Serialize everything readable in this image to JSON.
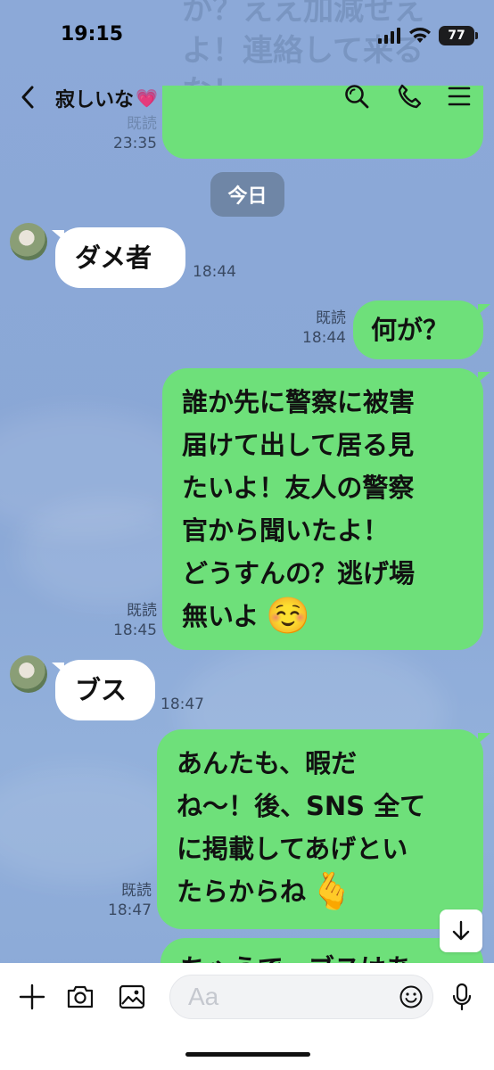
{
  "status_bar": {
    "time": "19:15",
    "battery": "77",
    "icons": [
      "signal-icon",
      "wifi-icon",
      "battery-icon"
    ]
  },
  "header": {
    "title": "寂しいな",
    "title_emoji": "💗",
    "icons": [
      "back-chevron-icon",
      "search-icon",
      "phone-icon",
      "menu-icon"
    ]
  },
  "overlay_text": "か？ええ加減せえよ！連絡して来るな！",
  "date_chip": "今日",
  "messages": [
    {
      "id": "prev",
      "direction": "out",
      "text": "",
      "read": "既読",
      "time": "23:35"
    },
    {
      "id": "m1",
      "direction": "in",
      "text": "ダメ者",
      "time": "18:44"
    },
    {
      "id": "m2",
      "direction": "out",
      "text": "何が？",
      "read": "既読",
      "time": "18:44"
    },
    {
      "id": "m3",
      "direction": "out",
      "lines": [
        "誰か先に警察に被害",
        "届けて出して居る見",
        "たいよ！友人の警察",
        "官から聞いたよ！",
        "どうすんの？逃げ場",
        "無いよ"
      ],
      "emoji": "☺️",
      "read": "既読",
      "time": "18:45"
    },
    {
      "id": "m4",
      "direction": "in",
      "text": "ブス",
      "time": "18:47"
    },
    {
      "id": "m5",
      "direction": "out",
      "lines": [
        "あんたも、暇だ",
        "ね〜！後、SNS 全て",
        "に掲載してあげとい",
        "たらからね"
      ],
      "emoji": "🫰",
      "read": "既読",
      "time": "18:47"
    },
    {
      "id": "m6",
      "direction": "out",
      "text": "ちゃうで、ブスはあ"
    }
  ],
  "input": {
    "placeholder": "Aa",
    "icons": [
      "plus-icon",
      "camera-icon",
      "image-icon",
      "emoji-icon",
      "microphone-icon"
    ]
  },
  "colors": {
    "background": "#8aa9d6",
    "outgoing_bubble": "#6ee07a",
    "incoming_bubble": "#ffffff",
    "date_chip": "#6f86a6"
  }
}
